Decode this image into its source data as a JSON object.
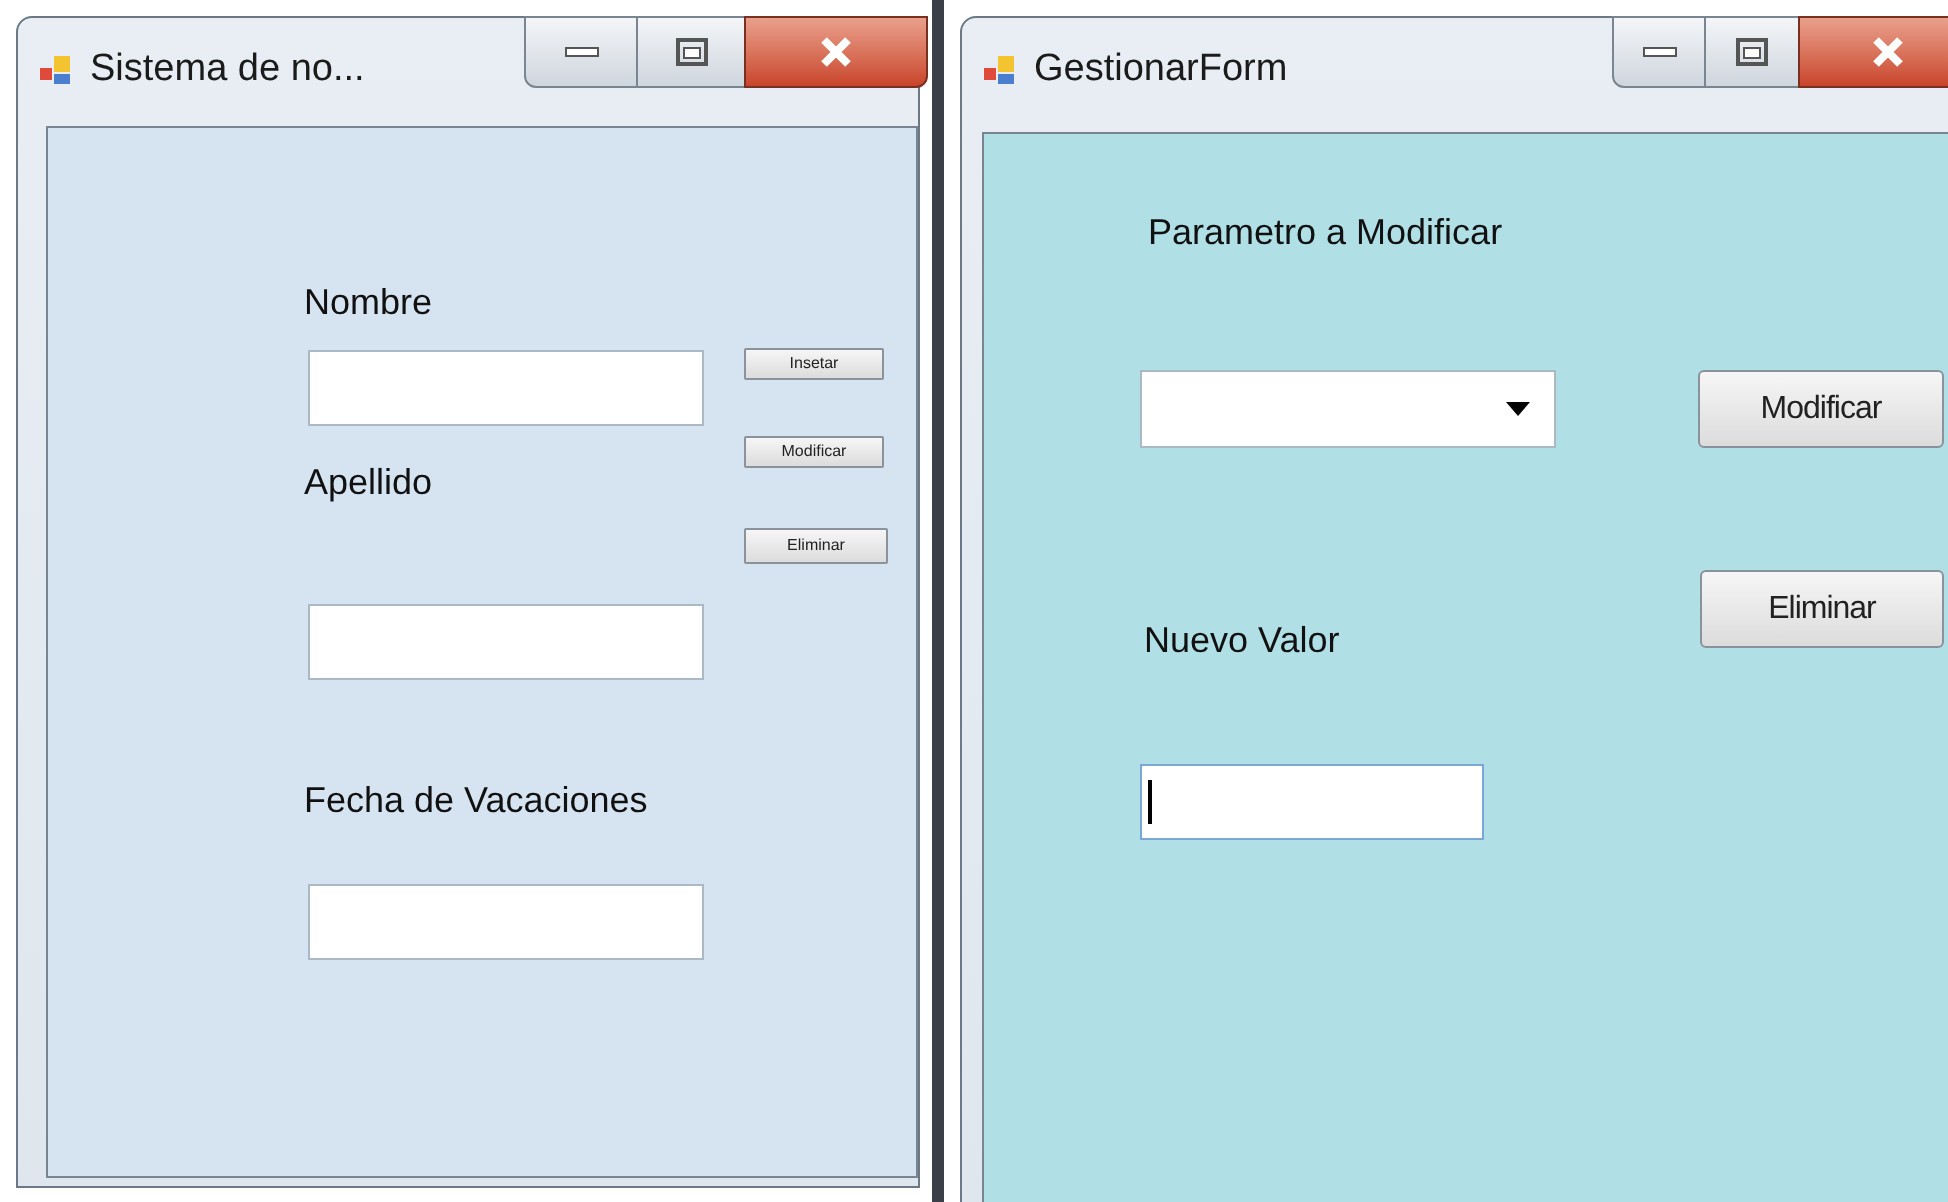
{
  "windows": [
    {
      "title": "Sistema de no...",
      "labels": [
        "Nombre",
        "Apellido",
        "Fecha de Vacaciones"
      ],
      "fields": [
        {
          "focused": false
        },
        {
          "focused": false
        },
        {
          "focused": false
        }
      ],
      "buttons": [
        "Insetar",
        "Modificar",
        "Eliminar"
      ]
    },
    {
      "title": "GestionarForm",
      "labels": [
        "Parametro a Modificar",
        "Nuevo Valor"
      ],
      "combo": {
        "focused": false
      },
      "fields": [
        {
          "focused": true
        }
      ],
      "buttons": [
        "Modificar",
        "Eliminar"
      ]
    }
  ]
}
